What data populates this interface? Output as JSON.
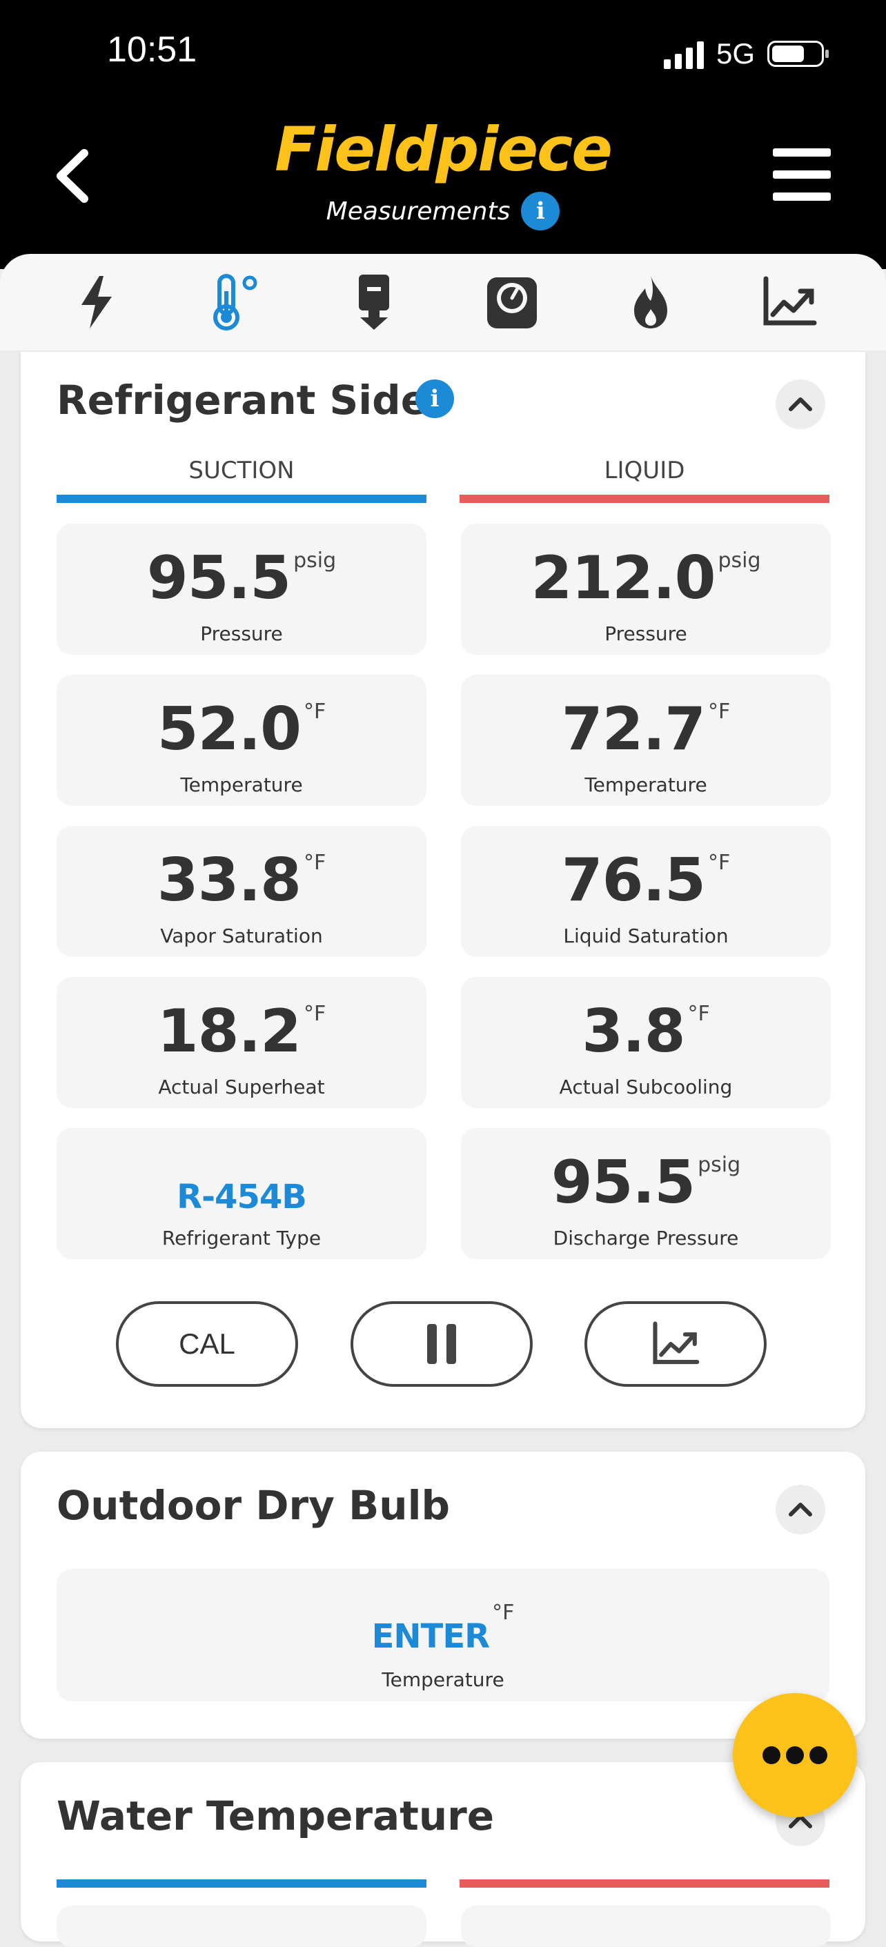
{
  "status": {
    "time": "10:51",
    "network": "5G"
  },
  "header": {
    "brand": "Fieldpiece",
    "subtitle": "Measurements"
  },
  "tabs": [
    {
      "icon": "lightning-icon",
      "active": false
    },
    {
      "icon": "thermometer-icon",
      "active": true
    },
    {
      "icon": "probe-icon",
      "active": false
    },
    {
      "icon": "gauge-icon",
      "active": false
    },
    {
      "icon": "flame-icon",
      "active": false
    },
    {
      "icon": "chart-icon",
      "active": false
    }
  ],
  "refrigerant": {
    "title": "Refrigerant Side",
    "suction_label": "SUCTION",
    "liquid_label": "LIQUID",
    "tiles": [
      {
        "value": "95.5",
        "unit": "psig",
        "label": "Pressure"
      },
      {
        "value": "212.0",
        "unit": "psig",
        "label": "Pressure"
      },
      {
        "value": "52.0",
        "unit": "°F",
        "label": "Temperature"
      },
      {
        "value": "72.7",
        "unit": "°F",
        "label": "Temperature"
      },
      {
        "value": "33.8",
        "unit": "°F",
        "label": "Vapor Saturation"
      },
      {
        "value": "76.5",
        "unit": "°F",
        "label": "Liquid Saturation"
      },
      {
        "value": "18.2",
        "unit": "°F",
        "label": "Actual Superheat"
      },
      {
        "value": "3.8",
        "unit": "°F",
        "label": "Actual Subcooling"
      },
      {
        "value": "R-454B",
        "unit": "",
        "label": "Refrigerant Type"
      },
      {
        "value": "95.5",
        "unit": "psig",
        "label": "Discharge Pressure"
      }
    ],
    "cal_label": "CAL"
  },
  "outdoor": {
    "title": "Outdoor Dry Bulb",
    "value": "ENTER",
    "unit": "°F",
    "label": "Temperature"
  },
  "water": {
    "title": "Water Temperature"
  },
  "colors": {
    "accent": "#fcc21a",
    "blue": "#1c8ad6",
    "red": "#e85c5c"
  }
}
